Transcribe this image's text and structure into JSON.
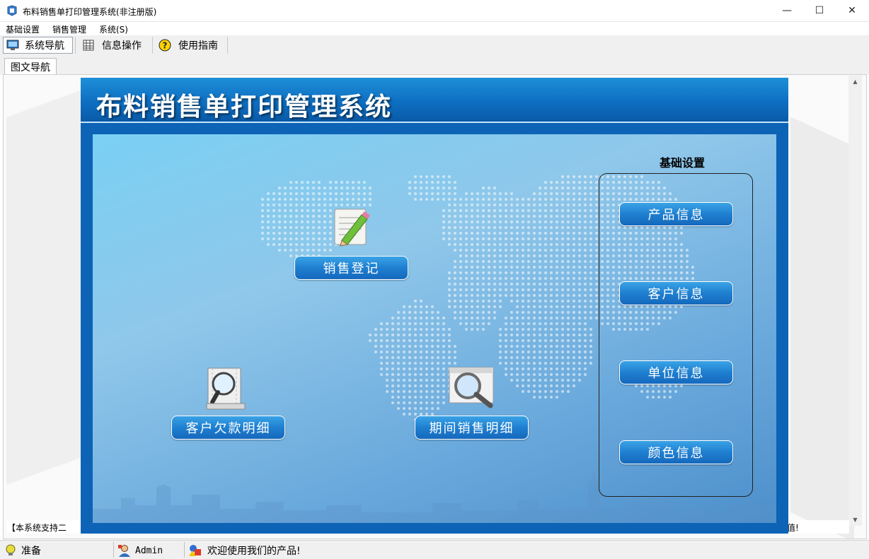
{
  "window": {
    "title": "布料销售单打印管理系统(非注册版)",
    "minimize_glyph": "—",
    "maximize_glyph": "☐",
    "close_glyph": "✕"
  },
  "menu": [
    "基础设置",
    "销售管理",
    "系统(S)"
  ],
  "toolbar": [
    {
      "label": "系统导航",
      "icon": "monitor-icon",
      "active": true
    },
    {
      "label": "信息操作",
      "icon": "grid-icon",
      "active": false
    },
    {
      "label": "使用指南",
      "icon": "help-icon",
      "active": false
    }
  ],
  "tabs": [
    "图文导航"
  ],
  "panel": {
    "title": "布料销售单打印管理系统",
    "buttons": {
      "sales_register": "销售登记",
      "customer_debt": "客户欠款明细",
      "period_sales": "期间销售明细"
    },
    "side": {
      "title": "基础设置",
      "items": [
        "产品信息",
        "客户信息",
        "单位信息",
        "颜色信息"
      ]
    }
  },
  "notice": {
    "left": "【本系统支持二",
    "right": "值!"
  },
  "status": {
    "state": "准备",
    "user": "Admin",
    "message": "欢迎使用我们的产品!"
  },
  "colors": {
    "panel_blue": "#0d63b5",
    "button_blue": "#1f7fd0"
  }
}
